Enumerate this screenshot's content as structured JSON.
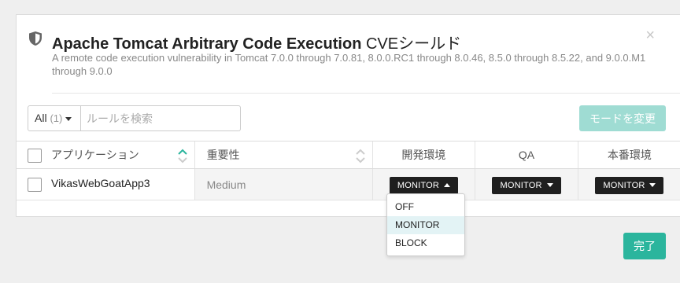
{
  "modal": {
    "title_bold": "Apache Tomcat Arbitrary Code Execution",
    "title_suffix": " CVEシールド",
    "description": "A remote code execution vulnerability in Tomcat 7.0.0 through 7.0.81, 8.0.0.RC1 through 8.0.46, 8.5.0 through 8.5.22, and 9.0.0.M1 through 9.0.0",
    "close_glyph": "×"
  },
  "filter": {
    "label": "All",
    "count": "(1)"
  },
  "search": {
    "placeholder": "ルールを検索"
  },
  "mode_button": "モードを変更",
  "table": {
    "headers": {
      "application": "アプリケーション",
      "severity": "重要性",
      "env_dev": "開発環境",
      "env_qa": "QA",
      "env_prod": "本番環境"
    },
    "rows": [
      {
        "application": "VikasWebGoatApp3",
        "severity": "Medium",
        "dev": "MONITOR",
        "qa": "MONITOR",
        "prod": "MONITOR"
      }
    ]
  },
  "dropdown": {
    "options": [
      "OFF",
      "MONITOR",
      "BLOCK"
    ],
    "selected": "MONITOR"
  },
  "done_button": "完了",
  "colors": {
    "accent": "#2bb59d",
    "accent_disabled": "#9fdcd3",
    "monitor_bg": "#1f1f1f"
  }
}
